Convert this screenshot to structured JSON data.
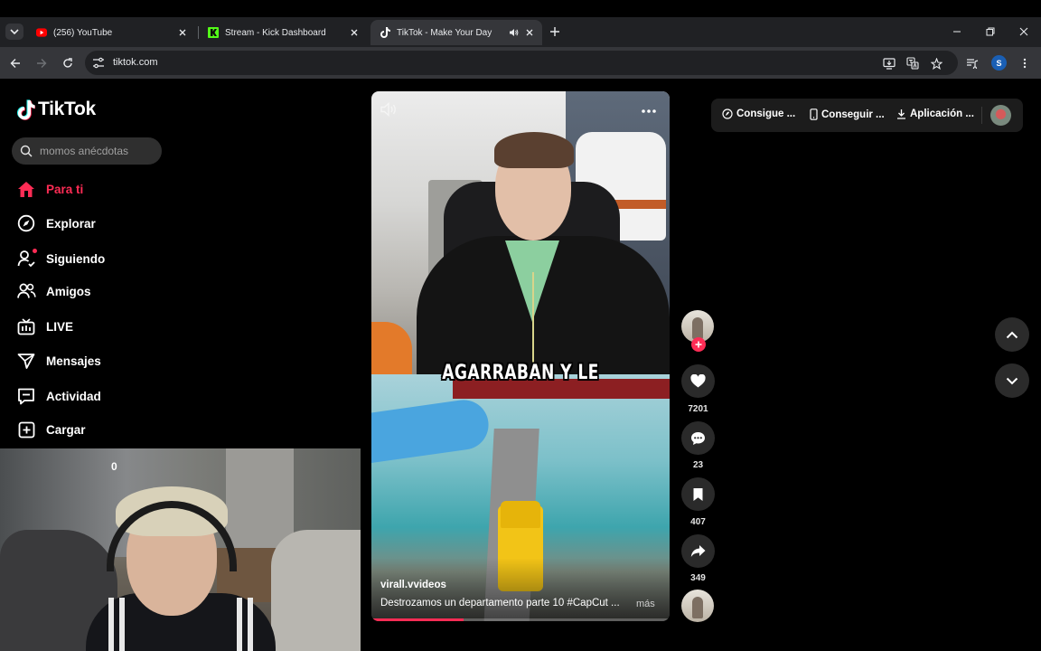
{
  "browser": {
    "tabs": [
      {
        "title": "(256) YouTube",
        "icon": "youtube-icon"
      },
      {
        "title": "Stream - Kick Dashboard",
        "icon": "kick-icon"
      },
      {
        "title": "TikTok - Make Your Day",
        "icon": "tiktok-icon",
        "active": true
      }
    ],
    "url": "tiktok.com",
    "profile_initial": "S"
  },
  "tiktok": {
    "logo": "TikTok",
    "search_placeholder": "momos anécdotas",
    "nav": [
      {
        "label": "Para ti",
        "icon": "home-icon",
        "active": true
      },
      {
        "label": "Explorar",
        "icon": "compass-icon"
      },
      {
        "label": "Siguiendo",
        "icon": "following-icon"
      },
      {
        "label": "Amigos",
        "icon": "friends-icon"
      },
      {
        "label": "LIVE",
        "icon": "live-icon"
      },
      {
        "label": "Mensajes",
        "icon": "messages-icon"
      },
      {
        "label": "Actividad",
        "icon": "activity-icon"
      },
      {
        "label": "Cargar",
        "icon": "upload-icon"
      }
    ],
    "topbar": {
      "coins": "Consigue ...",
      "app": "Conseguir ...",
      "download": "Aplicación ..."
    }
  },
  "video": {
    "overlay_caption": "AGARRABAN Y LE",
    "author": "virall.vvideos",
    "description": "Destrozamos un departamento parte 10 #CapCut ...",
    "more": "más",
    "progress": 0.31,
    "likes": "7201",
    "comments": "23",
    "saves": "407",
    "shares": "349"
  },
  "webcam": {
    "counter": "0"
  },
  "colors": {
    "accent": "#fe2c55",
    "chrome_dark": "#202124",
    "chrome_toolbar": "#35363a"
  }
}
